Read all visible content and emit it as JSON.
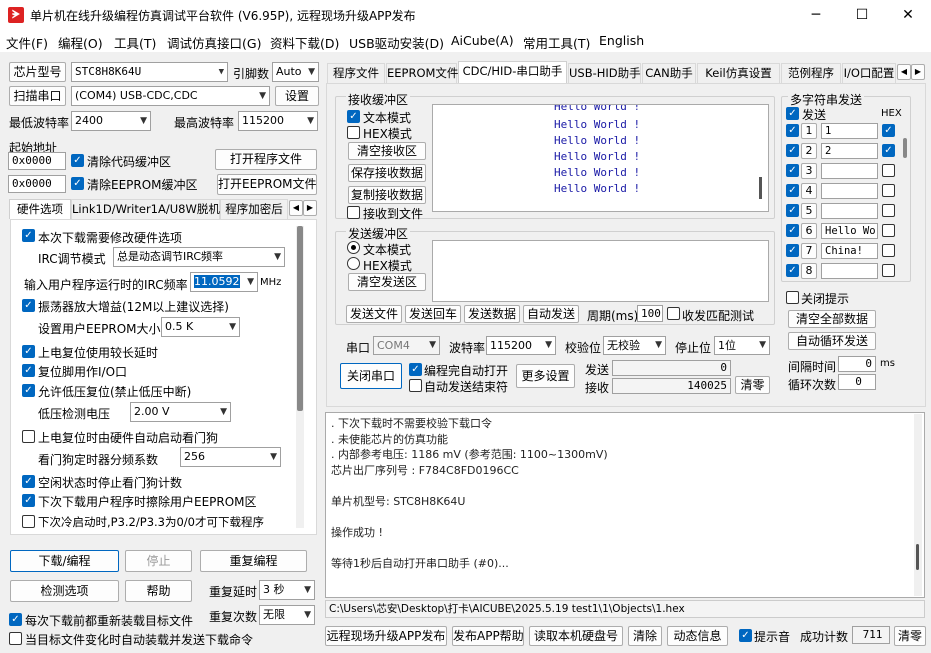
{
  "window": {
    "title": "单片机在线升级编程仿真调试平台软件 (V6.95P), 远程现场升级APP发布",
    "min": "─",
    "max": "☐",
    "close": "✕"
  },
  "menu": [
    "文件(F)",
    "编程(O)",
    "工具(T)",
    "调试仿真接口(G)",
    "资料下载(D)",
    "USB驱动安装(D)",
    "AiCube(A)",
    "常用工具(T)",
    "English"
  ],
  "left": {
    "chip_type_btn": "芯片型号",
    "chip_type_value": "STC8H8K64U",
    "pin_label": "引脚数",
    "pin_value": "Auto",
    "scan_port_btn": "扫描串口",
    "port_value": "(COM4) USB-CDC,CDC",
    "settings_btn": "设置",
    "min_baud_label": "最低波特率",
    "min_baud_value": "2400",
    "max_baud_label": "最高波特率",
    "max_baud_value": "115200",
    "start_addr_label": "起始地址",
    "addr1": "0x0000",
    "clear_code_label": "清除代码缓冲区",
    "open_prog_btn": "打开程序文件",
    "addr2": "0x0000",
    "clear_eeprom_label": "清除EEPROM缓冲区",
    "open_eeprom_btn": "打开EEPROM文件",
    "tabs": [
      "硬件选项",
      "Link1D/Writer1A/U8W脱机",
      "程序加密后"
    ],
    "hw": {
      "opt_modify": "本次下载需要修改硬件选项",
      "irc_mode_label": "IRC调节模式",
      "irc_mode_value": "总是动态调节IRC频率",
      "irc_freq_label": "输入用户程序运行时的IRC频率",
      "irc_freq_value": "11.0592",
      "irc_unit": "MHz",
      "osc_gain": "振荡器放大增益(12M以上建议选择)",
      "eeprom_size_label": "设置用户EEPROM大小",
      "eeprom_size_value": "0.5 K",
      "power_delay": "上电复位使用较长延时",
      "reset_io": "复位脚用作I/O口",
      "lvr": "允许低压复位(禁止低压中断)",
      "lvd_label": "低压检测电压",
      "lvd_value": "2.00 V",
      "wdt_auto": "上电复位时由硬件自动启动看门狗",
      "wdt_div_label": "看门狗定时器分频系数",
      "wdt_div_value": "256",
      "idle_stop_wdt": "空闲状态时停止看门狗计数",
      "erase_eeprom": "下次下载用户程序时擦除用户EEPROM区",
      "p32_p33": "下次冷启动时,P3.2/P3.3为0/0才可下载程序"
    },
    "download_btn": "下载/编程",
    "stop_btn": "停止",
    "reprogram_btn": "重复编程",
    "detect_btn": "检测选项",
    "help_btn": "帮助",
    "repeat_delay_label": "重复延时",
    "repeat_delay_value": "3 秒",
    "repeat_count_label": "重复次数",
    "repeat_count_value": "无限",
    "reload_each": "每次下载前都重新装载目标文件",
    "auto_on_change": "当目标文件变化时自动装载并发送下载命令"
  },
  "right": {
    "tabs": [
      "程序文件",
      "EEPROM文件",
      "CDC/HID-串口助手",
      "USB-HID助手",
      "CAN助手",
      "Keil仿真设置",
      "范例程序",
      "I/O口配置"
    ],
    "recv": {
      "group_label": "接收缓冲区",
      "text_mode": "文本模式",
      "hex_mode": "HEX模式",
      "clear_btn": "清空接收区",
      "save_btn": "保存接收数据",
      "copy_btn": "复制接收数据",
      "to_file": "接收到文件",
      "lines": [
        "Hello World !",
        "Hello World !",
        "Hello World !",
        "Hello World !",
        "Hello World !",
        "Hello World !"
      ]
    },
    "send": {
      "group_label": "发送缓冲区",
      "text_mode": "文本模式",
      "hex_mode": "HEX模式",
      "clear_btn": "清空发送区",
      "send_file_btn": "发送文件",
      "send_enter_btn": "发送回车",
      "send_data_btn": "发送数据",
      "auto_send_btn": "自动发送",
      "period_label": "周期(ms)",
      "period_value": "100",
      "match_label": "收发匹配测试"
    },
    "port": {
      "port_label": "串口",
      "port_value": "COM4",
      "baud_label": "波特率",
      "baud_value": "115200",
      "parity_label": "校验位",
      "parity_value": "无校验",
      "stop_label": "停止位",
      "stop_value": "1位",
      "close_btn": "关闭串口",
      "auto_open": "编程完自动打开",
      "auto_send_end": "自动发送结束符",
      "more_btn": "更多设置",
      "send_label": "发送",
      "send_count": "0",
      "recv_label": "接收",
      "recv_count": "140025",
      "clear_btn": "清零"
    },
    "multi": {
      "group_label": "多字符串发送",
      "send_col": "发送",
      "hex_col": "HEX",
      "rows": [
        {
          "n": "1",
          "text": "1"
        },
        {
          "n": "2",
          "text": "2"
        },
        {
          "n": "3",
          "text": ""
        },
        {
          "n": "4",
          "text": ""
        },
        {
          "n": "5",
          "text": ""
        },
        {
          "n": "6",
          "text": "Hello Wor"
        },
        {
          "n": "7",
          "text": "China!"
        },
        {
          "n": "8",
          "text": ""
        }
      ],
      "close_hint": "关闭提示",
      "clear_all_btn": "清空全部数据",
      "auto_loop_btn": "自动循环发送",
      "interval_label": "间隔时间",
      "interval_value": "0",
      "interval_unit": "ms",
      "loop_label": "循环次数",
      "loop_value": "0"
    },
    "log": [
      ". 下次下载时不需要校验下载口令",
      ". 未使能芯片的仿真功能",
      ". 内部参考电压: 1186 mV (参考范围: 1100~1300mV)",
      "芯片出厂序列号 : F784C8FD0196CC",
      "",
      "  单片机型号: STC8H8K64U",
      "",
      "操作成功 !",
      "",
      "等待1秒后自动打开串口助手 (#0)..."
    ],
    "path": "C:\\Users\\芯安\\Desktop\\打卡\\AICUBE\\2025.5.19 test1\\1\\Objects\\1.hex",
    "bottom": {
      "remote_btn": "远程现场升级APP发布",
      "publish_help_btn": "发布APP帮助",
      "read_disk_btn": "读取本机硬盘号",
      "clear_btn": "清除",
      "anim_btn": "动态信息",
      "beep_label": "提示音",
      "success_label": "成功计数",
      "success_value": "711",
      "zero_btn": "清零"
    }
  }
}
